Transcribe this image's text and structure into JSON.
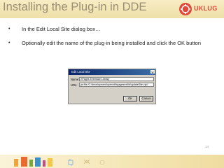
{
  "slide": {
    "title": "Installing the Plug-in in DDE",
    "logo_text": "UKLUG",
    "bullets": [
      "In the Edit Local Site dialog box…",
      "Optionally edit the name of the plug-in being installed and click the OK button"
    ],
    "page_number": "14"
  },
  "dialog": {
    "title": "Edit Local Site",
    "close_glyph": "x",
    "name_label": "Name:",
    "name_value": "XPages Extension Library",
    "url_label": "URL:",
    "url_value": "jar:file:/C:/development/openntf/xpagesextlib/updateSite.zip!/",
    "ok_label": "OK",
    "cancel_label": "Cancel"
  },
  "colors": {
    "title_band": "#f3e7b8",
    "logo_red": "#e0493a",
    "dialog_title_bar": "#0a246a"
  }
}
